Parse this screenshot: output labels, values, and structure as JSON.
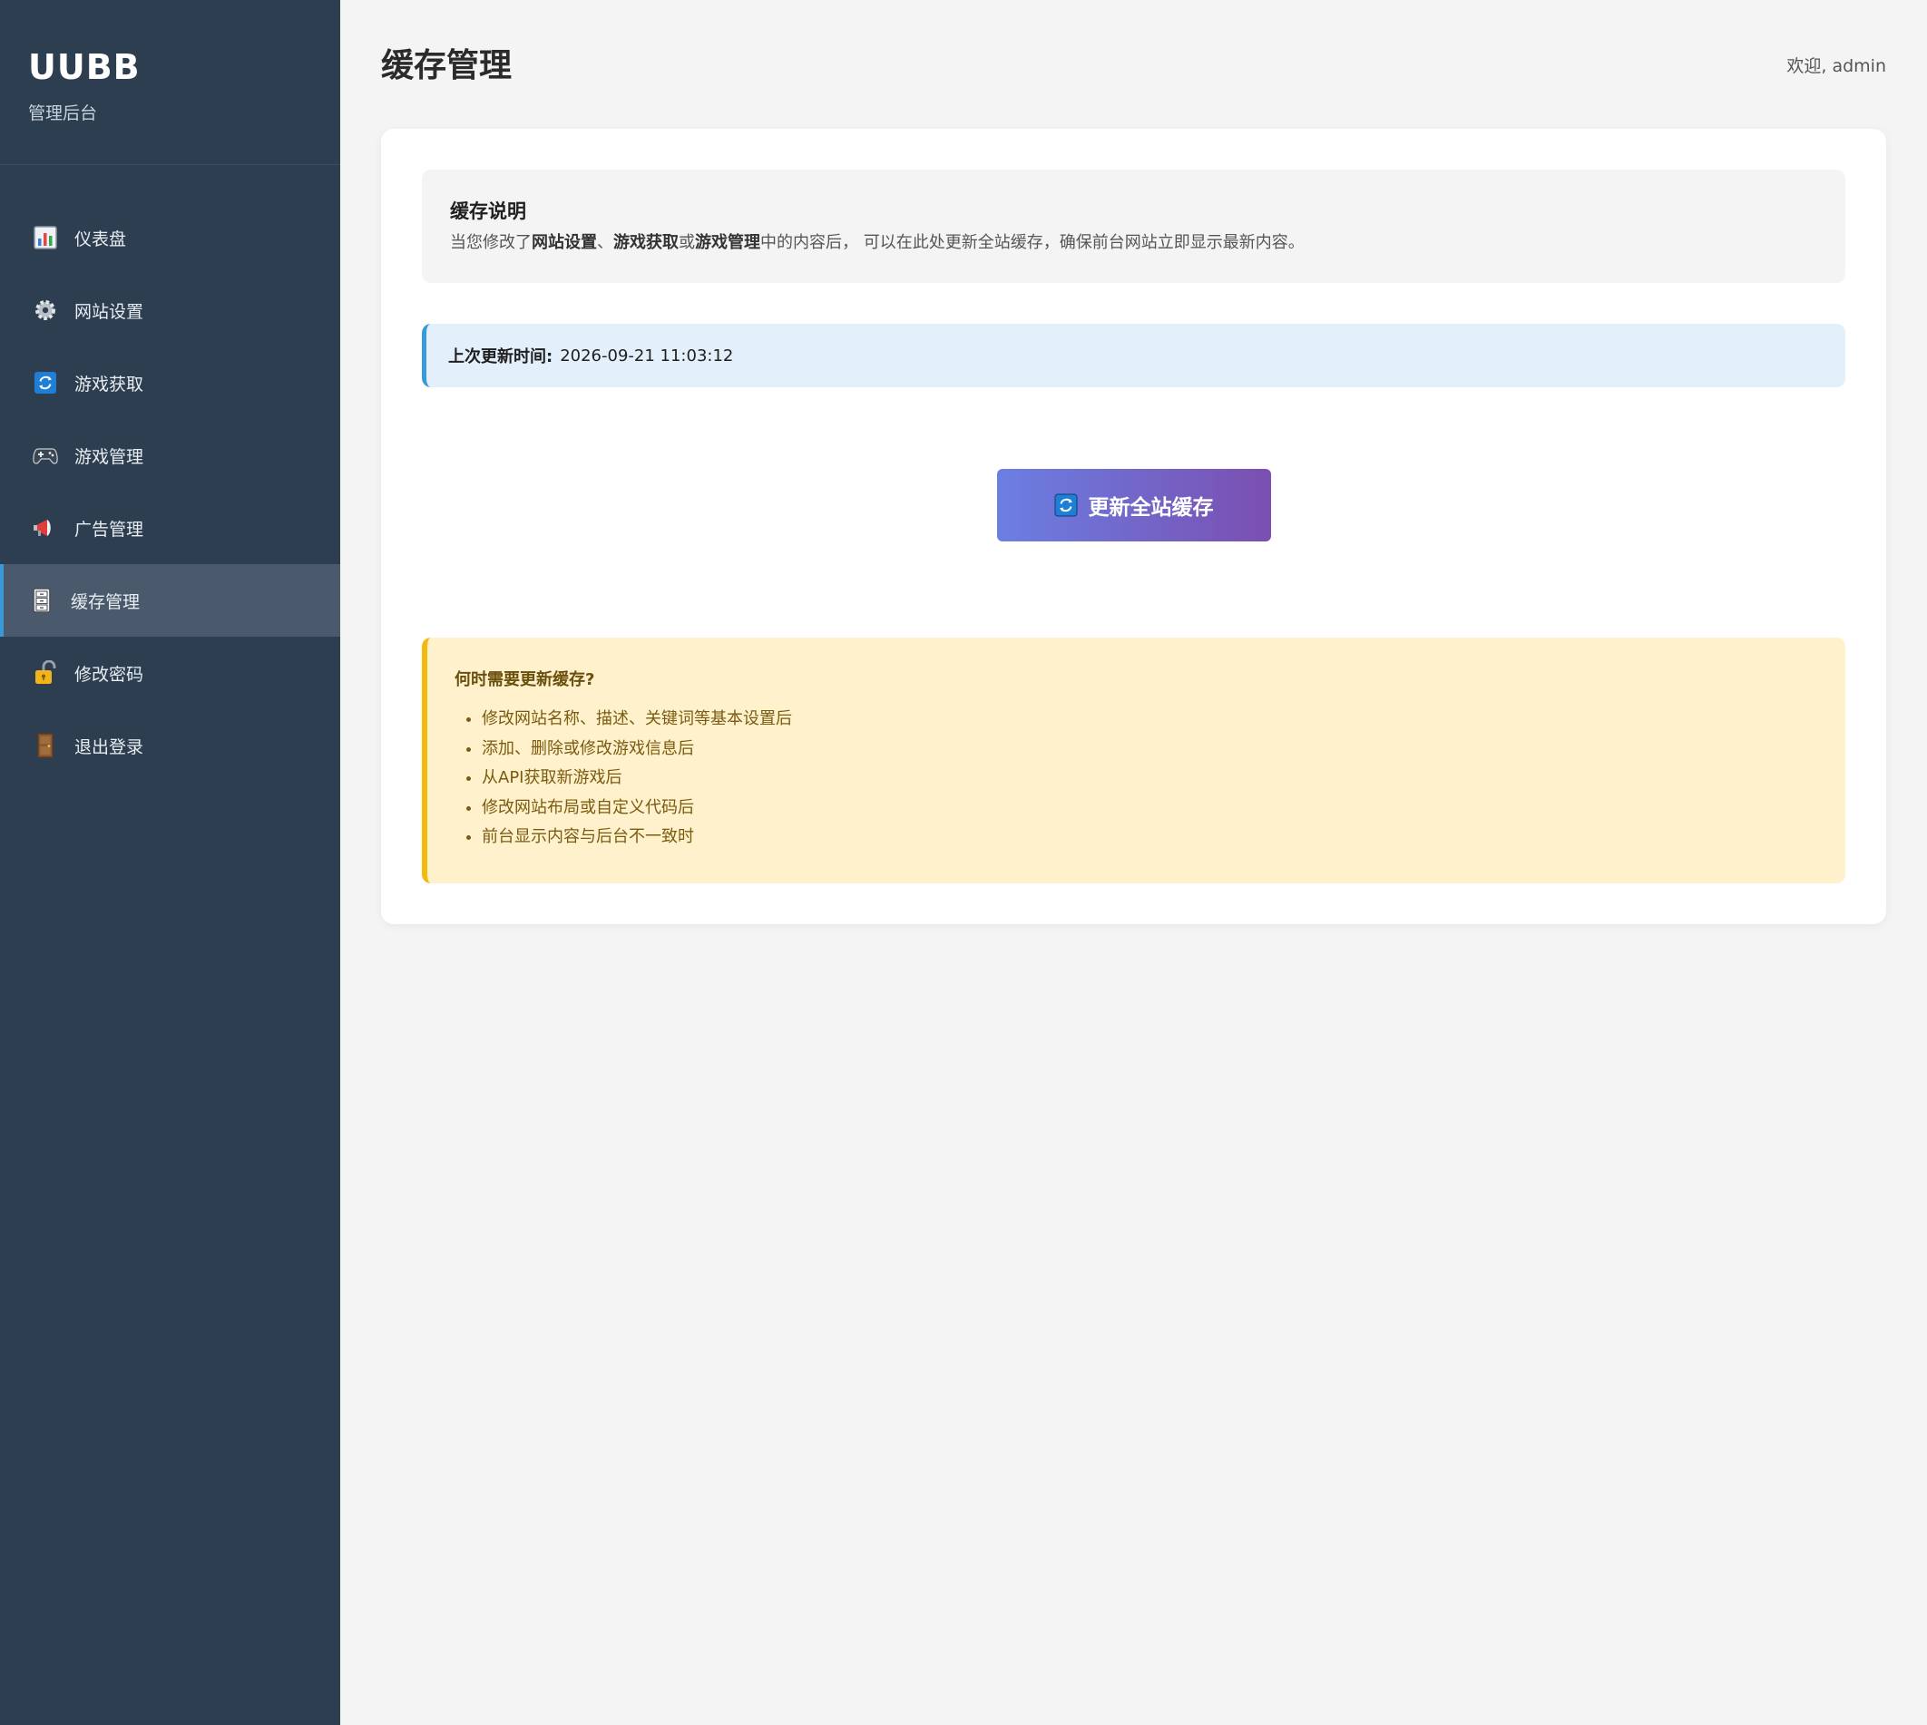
{
  "sidebar": {
    "brand_title": "UUBB",
    "brand_subtitle": "管理后台",
    "items": [
      {
        "label": "仪表盘",
        "icon": "bar-chart-icon"
      },
      {
        "label": "网站设置",
        "icon": "gear-icon"
      },
      {
        "label": "游戏获取",
        "icon": "refresh-icon"
      },
      {
        "label": "游戏管理",
        "icon": "gamepad-icon"
      },
      {
        "label": "广告管理",
        "icon": "megaphone-icon"
      },
      {
        "label": "缓存管理",
        "icon": "file-cabinet-icon",
        "active": true
      },
      {
        "label": "修改密码",
        "icon": "lock-icon"
      },
      {
        "label": "退出登录",
        "icon": "door-icon"
      }
    ]
  },
  "header": {
    "title": "缓存管理",
    "welcome": "欢迎, admin"
  },
  "description": {
    "title": "缓存说明",
    "text_1": "当您修改了",
    "bold_1": "网站设置",
    "text_2": "、",
    "bold_2": "游戏获取",
    "text_3": "或",
    "bold_3": "游戏管理",
    "text_4": "中的内容后， 可以在此处更新全站缓存，确保前台网站立即显示最新内容。"
  },
  "last_update": {
    "label": "上次更新时间:",
    "value": "2026-09-21 11:03:12"
  },
  "refresh_button": {
    "label": "更新全站缓存",
    "icon": "refresh-icon"
  },
  "tips": {
    "title": "何时需要更新缓存?",
    "items": [
      "修改网站名称、描述、关键词等基本设置后",
      "添加、删除或修改游戏信息后",
      "从API获取新游戏后",
      "修改网站布局或自定义代码后",
      "前台显示内容与后台不一致时"
    ]
  },
  "colors": {
    "sidebar_bg": "#2d3e50",
    "active_accent": "#3a9ad9",
    "button_gradient_start": "#6b7fe3",
    "button_gradient_end": "#7a4fb0",
    "tips_accent": "#f2b90f"
  }
}
